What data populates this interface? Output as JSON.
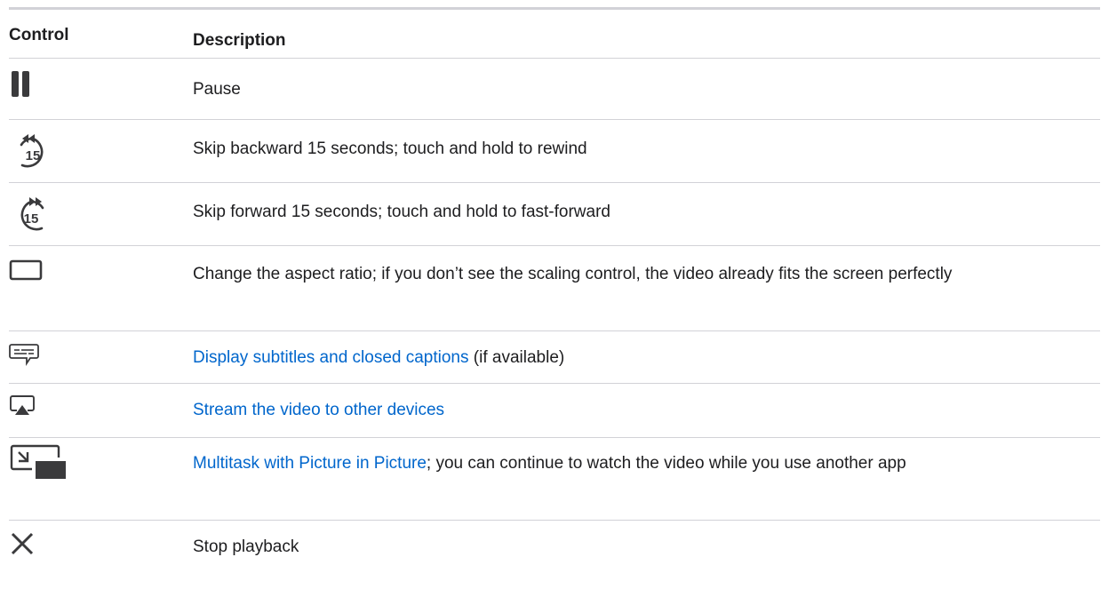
{
  "table": {
    "headers": {
      "control": "Control",
      "description": "Description"
    },
    "rows": [
      {
        "icon": "pause-icon",
        "parts": [
          {
            "text": "Pause",
            "link": false
          }
        ]
      },
      {
        "icon": "skip-backward-15-icon",
        "icon_text": "15",
        "parts": [
          {
            "text": "Skip backward 15 seconds; touch and hold to rewind",
            "link": false
          }
        ]
      },
      {
        "icon": "skip-forward-15-icon",
        "icon_text": "15",
        "parts": [
          {
            "text": "Skip forward 15 seconds; touch and hold to fast-forward",
            "link": false
          }
        ]
      },
      {
        "icon": "aspect-ratio-icon",
        "parts": [
          {
            "text": "Change the aspect ratio; if you don’t see the scaling control, the video already fits the screen perfectly",
            "link": false
          }
        ]
      },
      {
        "icon": "subtitles-icon",
        "parts": [
          {
            "text": "Display subtitles and closed captions",
            "link": true
          },
          {
            "text": " (if available)",
            "link": false
          }
        ]
      },
      {
        "icon": "airplay-icon",
        "parts": [
          {
            "text": "Stream the video to other devices",
            "link": true
          }
        ]
      },
      {
        "icon": "picture-in-picture-icon",
        "parts": [
          {
            "text": "Multitask with Picture in Picture",
            "link": true
          },
          {
            "text": "; you can continue to watch the video while you use another app",
            "link": false
          }
        ]
      },
      {
        "icon": "close-icon",
        "parts": [
          {
            "text": "Stop playback",
            "link": false
          }
        ]
      }
    ]
  },
  "colors": {
    "text": "#1d1d1f",
    "link": "#0066cc",
    "rule": "#d2d2d7",
    "icon": "#3a3a3c"
  }
}
